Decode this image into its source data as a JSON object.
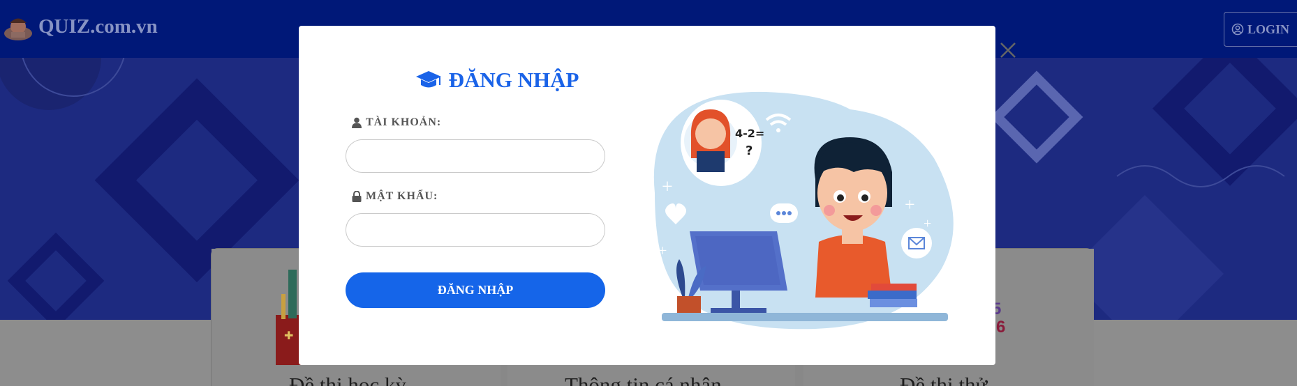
{
  "header": {
    "logo_text": "QUIZ.com.vn",
    "login_label": "LOGIN"
  },
  "cards": [
    {
      "title": "Đề thi học kỳ"
    },
    {
      "title": "Thông tin cá nhân"
    },
    {
      "title": "Đề thi thử"
    }
  ],
  "modal": {
    "title": "ĐĂNG NHẬP",
    "username_label": "TÀI KHOẢN:",
    "username_value": "",
    "password_label": "MẬT KHẨU:",
    "password_value": "",
    "submit_label": "ĐĂNG NHẬP",
    "illustration_text": "4-2=\n?"
  },
  "colors": {
    "header_bg": "#001878",
    "hero_bg": "#1d2a80",
    "accent": "#1565e9"
  },
  "icons": [
    "graduation-cap-icon",
    "user-icon",
    "lock-icon",
    "close-icon",
    "user-circle-icon"
  ]
}
